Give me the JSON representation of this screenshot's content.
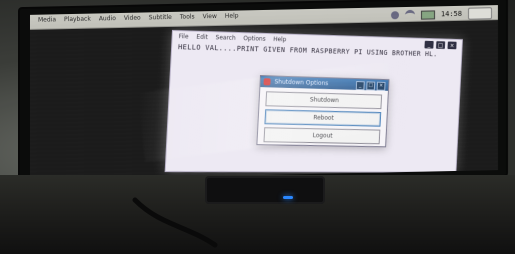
{
  "taskbar": {
    "menu_items": [
      "Media",
      "Playback",
      "Audio",
      "Video",
      "Subtitle",
      "Tools",
      "View",
      "Help"
    ],
    "clock": "14:58"
  },
  "terminal": {
    "menu_items": [
      "File",
      "Edit",
      "Search",
      "Options",
      "Help"
    ],
    "line": "HELLO VAL....PRINT GIVEN FROM RASPBERRY PI USING BROTHER HL."
  },
  "dialog": {
    "title": "Shutdown Options",
    "buttons": [
      "Shutdown",
      "Reboot",
      "Logout"
    ]
  },
  "icons": {
    "clock_color": "#111111",
    "accent_led": "#2a87ff"
  }
}
